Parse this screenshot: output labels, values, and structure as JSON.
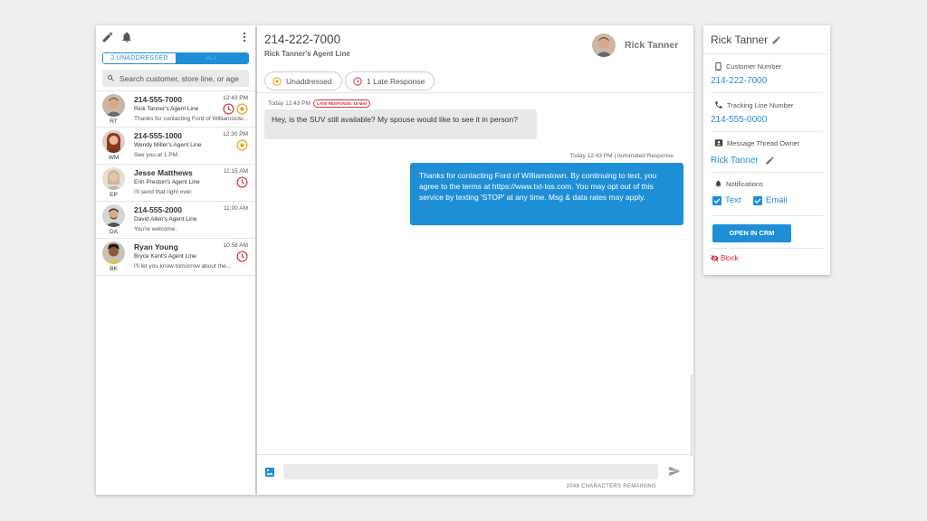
{
  "left_panel": {
    "tabs": {
      "unaddressed": "2 UNADDRESSED",
      "all": "ALL"
    },
    "search_placeholder": "Search customer, store line, or age",
    "conversations": [
      {
        "name": "214-555-7000",
        "agent_line": "Rick Tanner's Agent Line",
        "preview": "Thanks for contacting Ford of Williamstown...",
        "time": "12:43 PM",
        "initials": "RT",
        "status_icons": [
          "late-clock-icon",
          "unaddressed-icon"
        ]
      },
      {
        "name": "214-555-1000",
        "agent_line": "Wendy Miller's Agent Line",
        "preview": "See you at 1 PM.",
        "time": "12:30 PM",
        "initials": "WM",
        "status_icons": [
          "unaddressed-icon"
        ]
      },
      {
        "name": "Jesse Matthews",
        "agent_line": "Erin Preston's Agent Line",
        "preview": "I'll send that right over.",
        "time": "11:15 AM",
        "initials": "EP",
        "status_icons": [
          "late-clock-icon"
        ]
      },
      {
        "name": "214-555-2000",
        "agent_line": "David Allen's Agent Line",
        "preview": "You're welcome.",
        "time": "11:00 AM",
        "initials": "DA",
        "status_icons": []
      },
      {
        "name": "Ryan Young",
        "agent_line": "Bryce Kent's Agent Line",
        "preview": "I'll let you know tomorrow about the...",
        "time": "10:58 AM",
        "initials": "BK",
        "status_icons": [
          "late-clock-icon"
        ]
      }
    ]
  },
  "chat": {
    "phone": "214-222-7000",
    "agent_line": "Rick Tanner's Agent Line",
    "owner": "Rick Tanner",
    "filters": {
      "unaddressed": "Unaddressed",
      "late": "1 Late Response"
    },
    "incoming": {
      "meta": "Today 12:43 PM",
      "badge": "LATE RESPONSE: 15 MIN",
      "text": "Hey, is the SUV still available? My spouse would like to see it in person?"
    },
    "outgoing": {
      "meta": "Today 12:43 PM | Automated Response",
      "text": "Thanks for contacting Ford of Williamstown. By continuing to text, you agree to the terms at https://www.txt-tos.com. You may opt out of this service by texting 'STOP' at any time. Msg & data rates may apply."
    },
    "remaining": "2048 CHARACTERS REMAINING"
  },
  "right_panel": {
    "name": "Rick Tanner",
    "customer_number_label": "Customer Number",
    "customer_number": "214-222-7000",
    "tracking_label": "Tracking Line Number",
    "tracking_number": "214-555-0000",
    "owner_label": "Message Thread Owner",
    "owner": "Rick Tanner",
    "notifications_label": "Notifications",
    "notify_text": "Text",
    "notify_email": "Email",
    "crm_button": "OPEN IN CRM",
    "block": "Block"
  },
  "colors": {
    "accent": "#1e8fd6",
    "late": "#d0343b",
    "unaddressed": "#e8a317",
    "block": "#c62828"
  }
}
